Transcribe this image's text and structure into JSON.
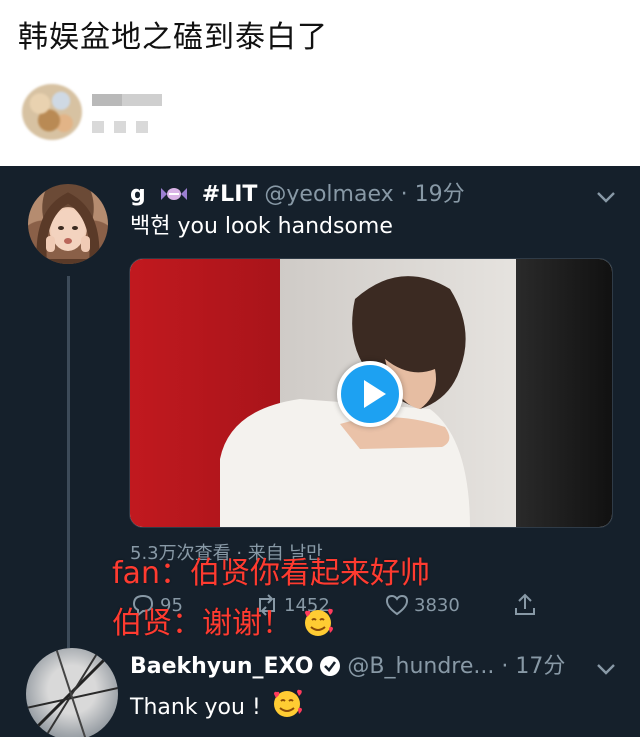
{
  "post": {
    "title": "韩娱盆地之磕到泰白了"
  },
  "tweet1": {
    "name": "g",
    "name_tag": "#LIT",
    "handle": "@yeolmaex · 19分",
    "text": "백현 you look handsome",
    "views": "5.3万次查看 · 来自 ",
    "views_source": "날만",
    "replies": "95",
    "retweets": "1452",
    "likes": "3830"
  },
  "captions": {
    "line1": "fan：伯贤你看起来好帅",
    "line2": "伯贤：谢谢！"
  },
  "tweet2": {
    "name": "Baekhyun_EXO",
    "handle": "@B_hundre... · 17分",
    "text": "Thank you !"
  },
  "colors": {
    "card_bg": "#15202b",
    "accent": "#1da1f2",
    "secondary_text": "#8899a6",
    "caption": "#ff3b30"
  },
  "icons": {
    "candy": "candy-icon",
    "play": "play-icon",
    "reply": "reply-icon",
    "retweet": "retweet-icon",
    "like": "heart-icon",
    "share": "share-icon",
    "verified": "verified-badge-icon",
    "emoji": "smiling-face-with-hearts-icon",
    "menu": "chevron-down-icon"
  }
}
